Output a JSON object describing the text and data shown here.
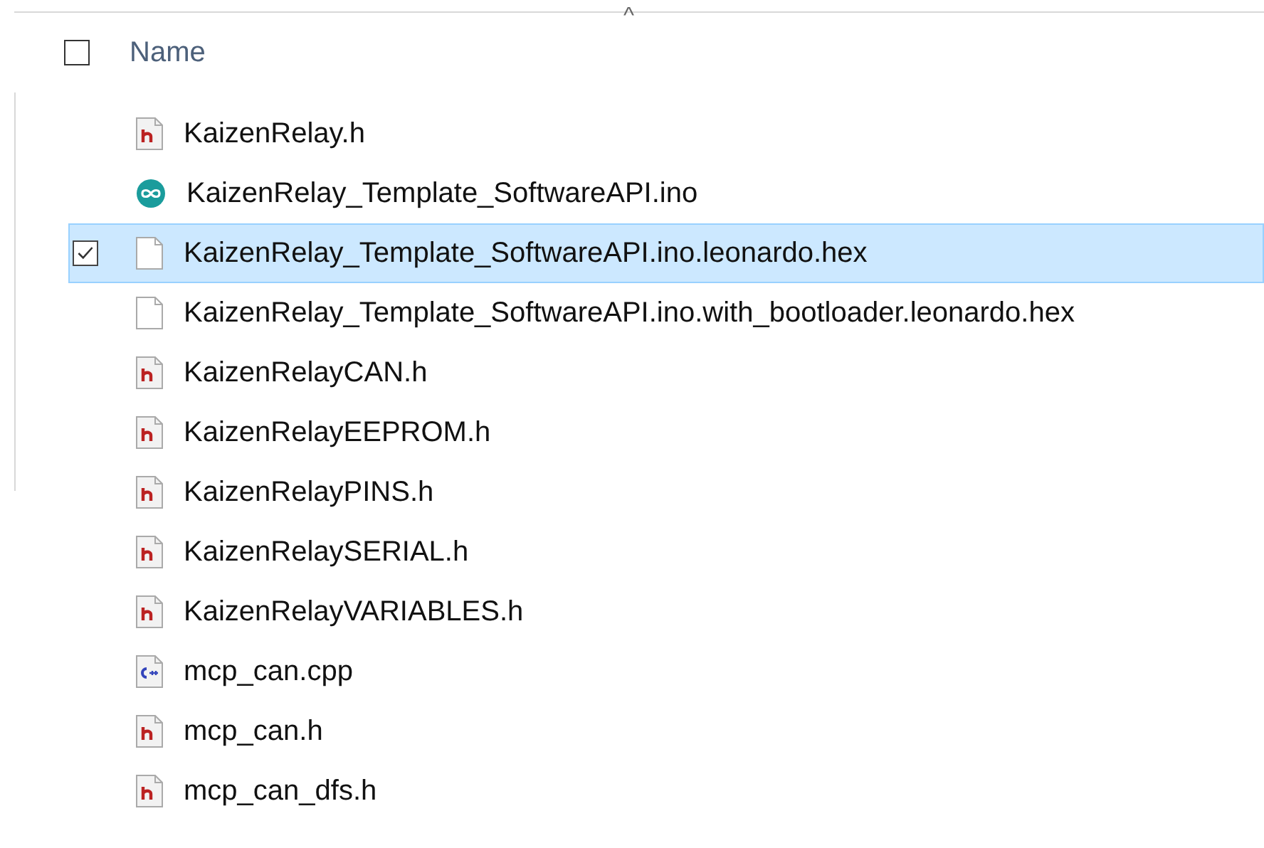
{
  "header": {
    "column": "Name",
    "sort_caret": "^",
    "checked": false
  },
  "files": [
    {
      "name": "KaizenRelay.h",
      "kind": "header",
      "selected": false
    },
    {
      "name": "KaizenRelay_Template_SoftwareAPI.ino",
      "kind": "arduino",
      "selected": false
    },
    {
      "name": "KaizenRelay_Template_SoftwareAPI.ino.leonardo.hex",
      "kind": "blank",
      "selected": true
    },
    {
      "name": "KaizenRelay_Template_SoftwareAPI.ino.with_bootloader.leonardo.hex",
      "kind": "blank",
      "selected": false
    },
    {
      "name": "KaizenRelayCAN.h",
      "kind": "header",
      "selected": false
    },
    {
      "name": "KaizenRelayEEPROM.h",
      "kind": "header",
      "selected": false
    },
    {
      "name": "KaizenRelayPINS.h",
      "kind": "header",
      "selected": false
    },
    {
      "name": "KaizenRelaySERIAL.h",
      "kind": "header",
      "selected": false
    },
    {
      "name": "KaizenRelayVARIABLES.h",
      "kind": "header",
      "selected": false
    },
    {
      "name": "mcp_can.cpp",
      "kind": "cpp",
      "selected": false
    },
    {
      "name": "mcp_can.h",
      "kind": "header",
      "selected": false
    },
    {
      "name": "mcp_can_dfs.h",
      "kind": "header",
      "selected": false
    }
  ]
}
